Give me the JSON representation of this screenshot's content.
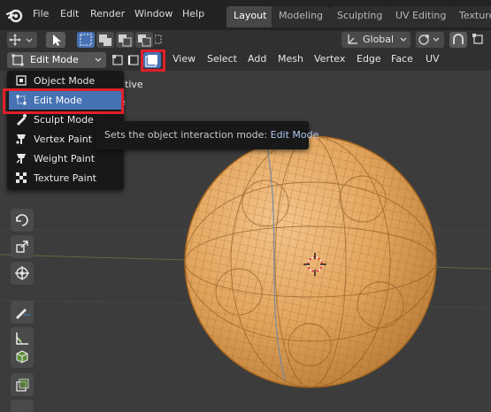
{
  "menubar": {
    "items": [
      "File",
      "Edit",
      "Render",
      "Window",
      "Help"
    ]
  },
  "workspaces": {
    "tabs": [
      "Layout",
      "Modeling",
      "Sculpting",
      "UV Editing",
      "Texture"
    ],
    "active": "Layout"
  },
  "header1": {
    "orientation_value": "Global"
  },
  "header2": {
    "mode_value": "Edit Mode",
    "menus": [
      "View",
      "Select",
      "Add",
      "Mesh",
      "Vertex",
      "Edge",
      "Face",
      "UV"
    ]
  },
  "viewport_overlay": {
    "text_line1": "ctive",
    "text_line2": "e"
  },
  "mode_dropdown": {
    "items": [
      {
        "label": "Object Mode",
        "icon": "object-mode-icon"
      },
      {
        "label": "Edit Mode",
        "icon": "edit-mode-icon"
      },
      {
        "label": "Sculpt Mode",
        "icon": "sculpt-mode-icon"
      },
      {
        "label": "Vertex Paint",
        "icon": "vertex-paint-icon"
      },
      {
        "label": "Weight Paint",
        "icon": "weight-paint-icon"
      },
      {
        "label": "Texture Paint",
        "icon": "texture-paint-icon"
      }
    ],
    "selected": "Edit Mode"
  },
  "tooltip": {
    "text": "Sets the object interaction mode:",
    "value": "Edit Mode"
  },
  "colors": {
    "selection_blue": "#4772b3",
    "annotation_red": "#e0202a",
    "mesh_orange": "#e8a24e"
  }
}
